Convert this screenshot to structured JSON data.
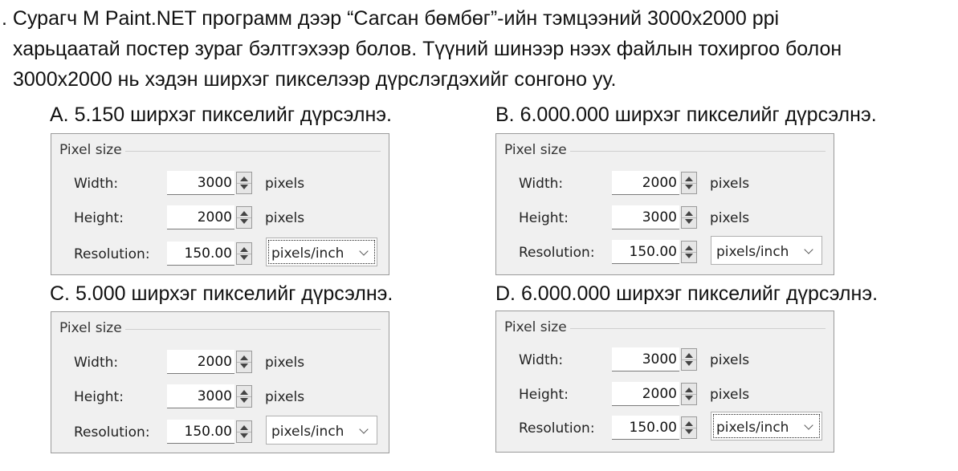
{
  "question": {
    "line1": ". Сурагч M Paint.NET программ дээр “Сагсан бөмбөг”-ийн тэмцээний 3000х2000 ppi",
    "line2": "харьцаатай постер зураг бэлтгэхээр болов. Түүний шинээр  нээх файлын тохиргоо болон",
    "line3": "3000x2000 нь хэдэн ширхэг пикселээр дүрслэгдэхийг сонгоно уу."
  },
  "options": [
    {
      "text": "A.  5.150  ширхэг  пикселийг  дүрсэлнэ.",
      "panel": {
        "legend": "Pixel size",
        "width_label": "Width:",
        "width": "3000",
        "height_label": "Height:",
        "height": "2000",
        "resolution_label": "Resolution:",
        "resolution": "150.00",
        "unit": "pixels",
        "res_unit": "pixels/inch"
      }
    },
    {
      "text": "B. 6.000.000 ширхэг пикселийг дүрсэлнэ.",
      "panel": {
        "legend": "Pixel size",
        "width_label": "Width:",
        "width": "2000",
        "height_label": "Height:",
        "height": "3000",
        "resolution_label": "Resolution:",
        "resolution": "150.00",
        "unit": "pixels",
        "res_unit": "pixels/inch"
      }
    },
    {
      "text": "C.  5.000  ширхэг  пикселийг  дүрсэлнэ.",
      "panel": {
        "legend": "Pixel size",
        "width_label": "Width:",
        "width": "2000",
        "height_label": "Height:",
        "height": "3000",
        "resolution_label": "Resolution:",
        "resolution": "150.00",
        "unit": "pixels",
        "res_unit": "pixels/inch"
      }
    },
    {
      "text": "D. 6.000.000 ширхэг пикселийг дүрсэлнэ.",
      "panel": {
        "legend": "Pixel size",
        "width_label": "Width:",
        "width": "3000",
        "height_label": "Height:",
        "height": "2000",
        "resolution_label": "Resolution:",
        "resolution": "150.00",
        "unit": "pixels",
        "res_unit": "pixels/inch"
      }
    }
  ]
}
